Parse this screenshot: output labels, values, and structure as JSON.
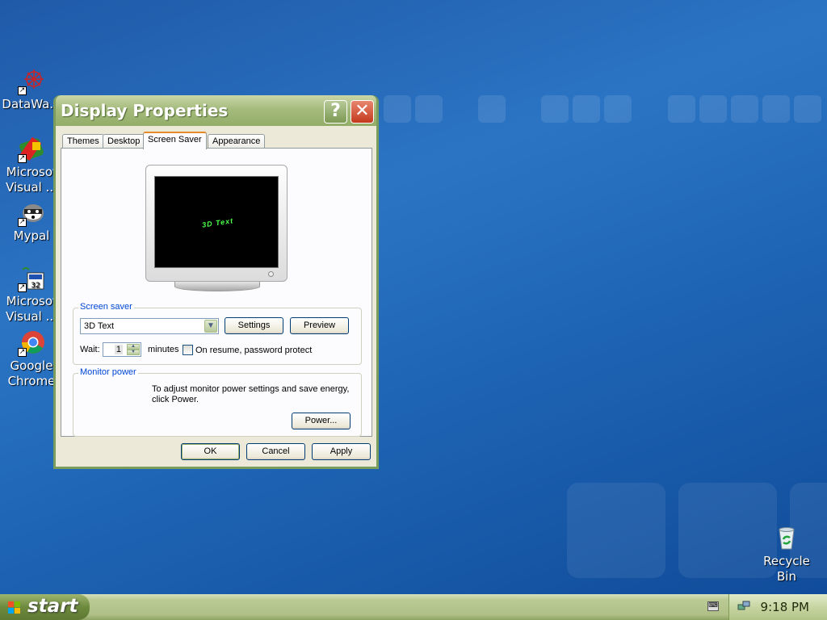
{
  "desktop": {
    "icons": [
      {
        "label": "DataWa..."
      },
      {
        "label": "Microsof",
        "label2": "Visual ..."
      },
      {
        "label": "Mypal"
      },
      {
        "label": "Microsof",
        "label2": "Visual ..."
      },
      {
        "label": "Google",
        "label2": "Chrome"
      },
      {
        "label": "Recycle",
        "label2": "Bin"
      }
    ]
  },
  "window": {
    "title": "Display Properties",
    "help_glyph": "?",
    "close_glyph": "✕",
    "tabs": [
      "Themes",
      "Desktop",
      "Screen Saver",
      "Appearance"
    ],
    "active_tab": "Screen Saver",
    "preview_text": "3D Text",
    "screen_saver": {
      "group_label": "Screen saver",
      "selected": "3D Text",
      "settings_label": "Settings",
      "preview_label": "Preview",
      "wait_label": "Wait:",
      "wait_value": "1",
      "minutes_label": "minutes",
      "password_label": "On resume, password protect",
      "password_checked": false
    },
    "monitor_power": {
      "group_label": "Monitor power",
      "text_line1": "To adjust monitor power settings and save energy,",
      "text_line2": "click Power.",
      "power_label": "Power..."
    },
    "buttons": {
      "ok": "OK",
      "cancel": "Cancel",
      "apply": "Apply"
    }
  },
  "taskbar": {
    "start_label": "start",
    "clock": "9:18 PM"
  },
  "colors": {
    "accent_active_tab": "#e68b2c",
    "group_label": "#0046d5"
  }
}
